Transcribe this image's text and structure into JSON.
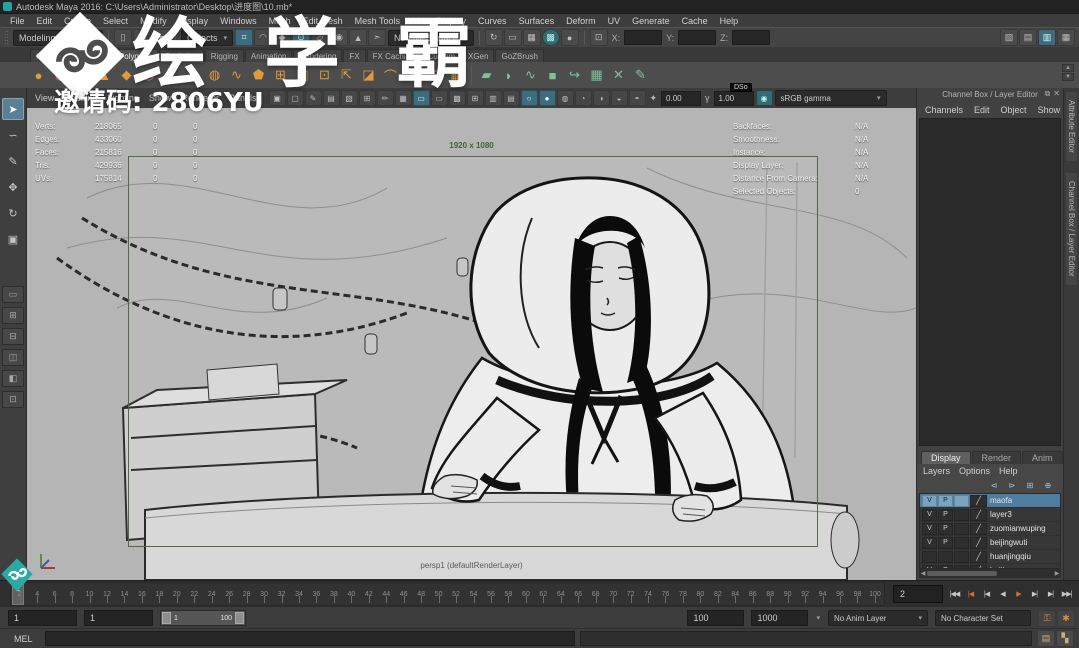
{
  "window": {
    "title": "Autodesk Maya 2016: C:\\Users\\Administrator\\Desktop\\进度图\\10.mb*"
  },
  "menubar": {
    "items": [
      "File",
      "Edit",
      "Create",
      "Select",
      "Modify",
      "Display",
      "Windows",
      "Mesh",
      "Edit Mesh",
      "Mesh Tools",
      "Mesh Display",
      "Curves",
      "Surfaces",
      "Deform",
      "UV",
      "Generate",
      "Cache",
      "Help"
    ]
  },
  "statusline": {
    "menuset": "Modeling",
    "selection_mask": "Objects",
    "no_live_surface": "No Live Surface",
    "x_label": "X:",
    "y_label": "Y:",
    "z_label": "Z:",
    "file_icons": [
      {
        "n": "new-scene-icon",
        "g": "▯"
      },
      {
        "n": "open-scene-icon",
        "g": "▤"
      },
      {
        "n": "save-scene-icon",
        "g": "▼"
      }
    ],
    "snap_icons": [
      {
        "n": "snap-to-grids-icon",
        "g": "⌗"
      },
      {
        "n": "snap-to-curves-icon",
        "g": "◠"
      },
      {
        "n": "snap-to-points-icon",
        "g": "◆"
      },
      {
        "n": "snap-to-projected-center-icon",
        "g": "⊙"
      },
      {
        "n": "snap-to-view-planes-icon",
        "g": "▱"
      },
      {
        "n": "make-object-live-icon",
        "g": "◉"
      },
      {
        "n": "lock-selection-icon",
        "g": "▲"
      },
      {
        "n": "highlight-selection-mode-icon",
        "g": "➣"
      }
    ],
    "render_icons": [
      {
        "n": "construction-history-icon",
        "g": "↻"
      },
      {
        "n": "open-render-view-icon",
        "g": "▭"
      },
      {
        "n": "render-current-frame-icon",
        "g": "▦"
      },
      {
        "n": "ipr-render-icon",
        "g": "▩"
      },
      {
        "n": "render-settings-icon",
        "g": "●"
      }
    ],
    "coord_icon": "⊡",
    "right_icons": [
      {
        "n": "modeling-toolkit-toggle-icon",
        "g": "▧"
      },
      {
        "n": "attribute-editor-toggle-icon",
        "g": "▤"
      },
      {
        "n": "tool-settings-toggle-icon",
        "g": "▥"
      },
      {
        "n": "channel-box-toggle-icon",
        "g": "▦"
      }
    ]
  },
  "shelf": {
    "tabs": [
      "Curves",
      "Surfaces",
      "Polygons",
      "Sculpting",
      "Rigging",
      "Animation",
      "Rendering",
      "FX",
      "FX Caching",
      "Custom",
      "XGen",
      "GoZBrush"
    ],
    "active_index": 2,
    "dso_label": "DSo",
    "poly_icons": [
      {
        "n": "poly-sphere-icon",
        "g": "●"
      },
      {
        "n": "poly-smooth-sphere-icon",
        "g": "◉"
      },
      {
        "n": "poly-cube-icon",
        "g": "■"
      },
      {
        "n": "poly-cone-icon",
        "g": "▲"
      },
      {
        "n": "poly-diamond-icon",
        "g": "◆"
      },
      {
        "n": "poly-torus-icon",
        "g": "◎"
      },
      {
        "n": "poly-pyramid-icon",
        "g": "▴"
      },
      {
        "n": "poly-cylinder-icon",
        "g": "▮"
      },
      {
        "n": "poly-pipe-icon",
        "g": "◍"
      },
      {
        "n": "poly-helix-icon",
        "g": "∿"
      },
      {
        "n": "poly-soccer-ball-icon",
        "g": "⬟"
      },
      {
        "n": "combine-icon",
        "g": "⊞"
      },
      {
        "n": "boolean-icon",
        "g": "◧"
      },
      {
        "n": "smooth-mesh-icon",
        "g": "⊡"
      },
      {
        "n": "extrude-icon",
        "g": "⇱"
      },
      {
        "n": "bevel-icon",
        "g": "◪"
      },
      {
        "n": "bridge-icon",
        "g": "⌒"
      },
      {
        "n": "multi-cut-icon",
        "g": "✂"
      },
      {
        "n": "insert-edge-loop-icon",
        "g": "◫"
      },
      {
        "n": "quad-draw-icon",
        "g": "▦"
      }
    ],
    "green_icons": [
      {
        "n": "green-plane-icon",
        "g": "▰"
      },
      {
        "n": "green-surface-icon",
        "g": "◗"
      },
      {
        "n": "green-wave-icon",
        "g": "∿"
      },
      {
        "n": "green-cube-icon",
        "g": "■"
      },
      {
        "n": "green-arrow-icon",
        "g": "↪"
      },
      {
        "n": "green-checker-box-icon",
        "g": "▦"
      },
      {
        "n": "green-cross-tools-icon",
        "g": "✕"
      },
      {
        "n": "dso-edit-icon",
        "g": "✎"
      }
    ]
  },
  "toolbox": {
    "tools": [
      {
        "n": "select-tool",
        "g": "➤"
      },
      {
        "n": "lasso-select-tool",
        "g": "∽"
      },
      {
        "n": "paint-select-tool",
        "g": "✎"
      },
      {
        "n": "move-tool",
        "g": "✥"
      },
      {
        "n": "rotate-tool",
        "g": "↻"
      },
      {
        "n": "scale-tool",
        "g": "▣"
      }
    ],
    "layouts": [
      {
        "n": "layout-single-pane",
        "g": "▭"
      },
      {
        "n": "layout-four-panes",
        "g": "⊞"
      },
      {
        "n": "layout-two-panes-stacked",
        "g": "⊟"
      },
      {
        "n": "layout-two-panes-side",
        "g": "◫"
      },
      {
        "n": "layout-persp-outliner",
        "g": "◧"
      },
      {
        "n": "layout-hypershade-persp",
        "g": "⊡"
      }
    ]
  },
  "viewport": {
    "menus": [
      "View",
      "Shading",
      "Lighting",
      "Show",
      "Renderer",
      "Panels"
    ],
    "icons": [
      {
        "n": "select-camera-icon",
        "g": "▣"
      },
      {
        "n": "lock-camera-icon",
        "g": "▢"
      },
      {
        "n": "camera-attributes-icon",
        "g": "✎"
      },
      {
        "n": "bookmark-icon",
        "g": "▤"
      },
      {
        "n": "image-plane-icon",
        "g": "▧"
      },
      {
        "n": "2d-pan-zoom-icon",
        "g": "⊞"
      },
      {
        "n": "grease-pencil-icon",
        "g": "✏"
      },
      {
        "n": "grid-icon",
        "g": "▦"
      },
      {
        "n": "film-gate-icon",
        "g": "▭"
      },
      {
        "n": "resolution-gate-icon",
        "g": "▭"
      },
      {
        "n": "gate-mask-icon",
        "g": "▩"
      },
      {
        "n": "field-chart-icon",
        "g": "⊞"
      },
      {
        "n": "safe-action-icon",
        "g": "▥"
      },
      {
        "n": "safe-title-icon",
        "g": "▤"
      },
      {
        "n": "wireframe-icon",
        "g": "○"
      },
      {
        "n": "smooth-shade-icon",
        "g": "●"
      },
      {
        "n": "textured-icon",
        "g": "◍"
      },
      {
        "n": "use-all-lights-icon",
        "g": "◔"
      },
      {
        "n": "shadows-icon",
        "g": "◑"
      },
      {
        "n": "screen-space-ao-icon",
        "g": "◒"
      },
      {
        "n": "motion-blur-icon",
        "g": "◓"
      }
    ],
    "exposure_icon": "✦",
    "exposure": "0.00",
    "gamma_icon": "γ",
    "gamma": "1.00",
    "view_transform_icon": "◉",
    "view_transform": "sRGB gamma",
    "resolution": "1920 x 1080",
    "camera_label": "persp1 (defaultRenderLayer)",
    "stats": [
      {
        "label": "Verts:",
        "total": "218065",
        "sel": "0",
        "other": "0"
      },
      {
        "label": "Edges:",
        "total": "433060",
        "sel": "0",
        "other": "0"
      },
      {
        "label": "Faces:",
        "total": "215816",
        "sel": "0",
        "other": "0"
      },
      {
        "label": "Tris:",
        "total": "429936",
        "sel": "0",
        "other": "0"
      },
      {
        "label": "UVs:",
        "total": "175814",
        "sel": "0",
        "other": "0"
      }
    ],
    "info": [
      {
        "label": "Backfaces:",
        "value": "N/A"
      },
      {
        "label": "Smoothness:",
        "value": "N/A"
      },
      {
        "label": "Instance:",
        "value": "N/A"
      },
      {
        "label": "Display Layer:",
        "value": "N/A"
      },
      {
        "label": "Distance From Camera:",
        "value": "N/A"
      },
      {
        "label": "Selected Objects:",
        "value": "0"
      }
    ]
  },
  "channel_box": {
    "title": "Channel Box / Layer Editor",
    "popout_icon": "⧉",
    "close_icon": "✕",
    "menus": [
      "Channels",
      "Edit",
      "Object",
      "Show"
    ],
    "side_tabs": [
      "Attribute Editor",
      "Channel Box / Layer Editor"
    ]
  },
  "layer_editor": {
    "tabs": [
      "Display",
      "Render",
      "Anim"
    ],
    "active_tab_index": 0,
    "menus": [
      "Layers",
      "Options",
      "Help"
    ],
    "buttons": [
      {
        "n": "select-layer-objects-icon",
        "g": "⊲"
      },
      {
        "n": "add-selected-to-layer-icon",
        "g": "⊳"
      },
      {
        "n": "create-layer-from-selected-icon",
        "g": "⊞"
      },
      {
        "n": "create-empty-layer-icon",
        "g": "⊕"
      }
    ],
    "selected_index": 0,
    "layers": [
      {
        "v": "V",
        "p": "P",
        "name": "maofa"
      },
      {
        "v": "V",
        "p": "P",
        "name": "layer3"
      },
      {
        "v": "V",
        "p": "P",
        "name": "zuomianwuping"
      },
      {
        "v": "V",
        "p": "P",
        "name": "beijingwuti"
      },
      {
        "v": "",
        "p": "",
        "name": "huanjingqiu"
      },
      {
        "v": "V",
        "p": "P",
        "name": "beijing"
      }
    ]
  },
  "timeline": {
    "ticks": [
      "2",
      "4",
      "6",
      "8",
      "10",
      "12",
      "14",
      "16",
      "18",
      "20",
      "22",
      "24",
      "26",
      "28",
      "30",
      "32",
      "34",
      "36",
      "38",
      "40",
      "42",
      "44",
      "46",
      "48",
      "50",
      "52",
      "54",
      "56",
      "58",
      "60",
      "62",
      "64",
      "66",
      "68",
      "70",
      "72",
      "74",
      "76",
      "78",
      "80",
      "82",
      "84",
      "86",
      "88",
      "90",
      "92",
      "94",
      "96",
      "98",
      "100"
    ],
    "playhead": "2",
    "current_frame": "2",
    "playback": [
      {
        "n": "go-to-start-button",
        "g": "|◀◀"
      },
      {
        "n": "step-back-frame-button",
        "g": "|◀"
      },
      {
        "n": "step-back-key-button",
        "g": "|◀"
      },
      {
        "n": "play-backwards-button",
        "g": "◀"
      },
      {
        "n": "play-forwards-button",
        "g": "▶"
      },
      {
        "n": "step-forward-key-button",
        "g": "▶|"
      },
      {
        "n": "step-forward-frame-button",
        "g": "▶|"
      },
      {
        "n": "go-to-end-button",
        "g": "▶▶|"
      }
    ]
  },
  "range": {
    "anim_start": "1",
    "playback_start": "1",
    "range_start": "1",
    "range_end": "100",
    "playback_end": "100",
    "anim_end": "1000",
    "anim_layer": "No Anim Layer",
    "character_set": "No Character Set",
    "icons": [
      {
        "n": "auto-keyframe-toggle-icon",
        "g": "⚿"
      },
      {
        "n": "animation-preferences-icon",
        "g": "✱"
      }
    ]
  },
  "command_line": {
    "label": "MEL",
    "icons": [
      {
        "n": "script-editor-icon",
        "g": "▤"
      },
      {
        "n": "command-shell-icon",
        "g": "▚"
      }
    ]
  },
  "watermark": {
    "brand": "绘学霸",
    "invite": "邀请码: 2806YU"
  }
}
